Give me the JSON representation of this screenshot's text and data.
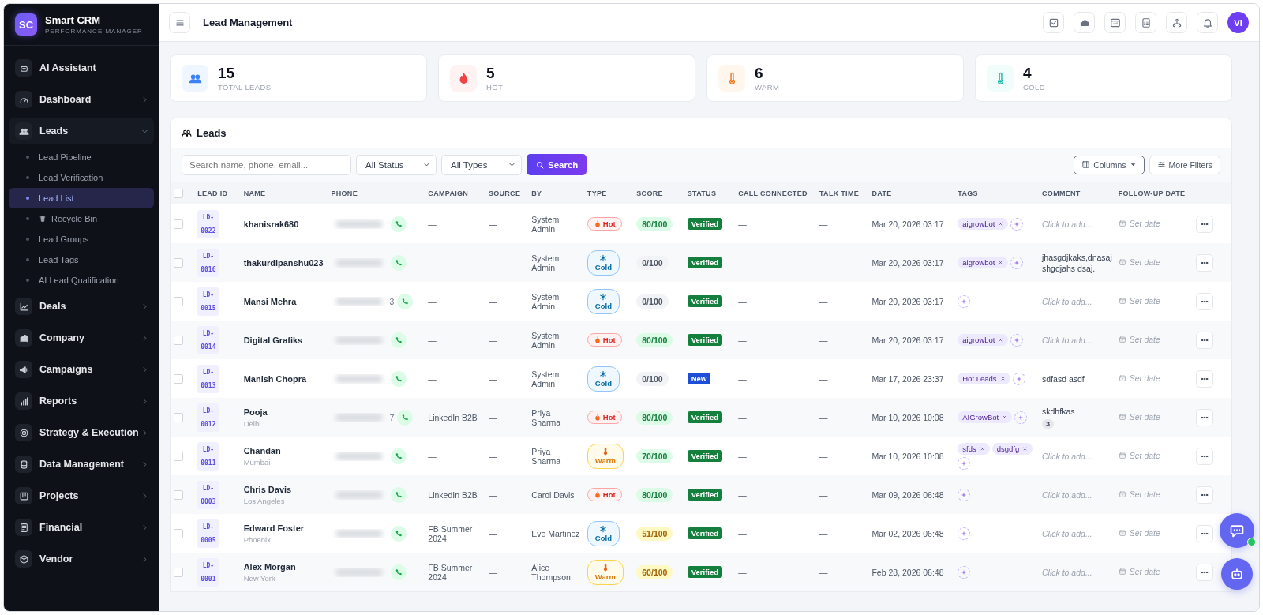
{
  "brand": {
    "logo": "SC",
    "name": "Smart CRM",
    "subtitle": "PERFORMANCE MANAGER"
  },
  "sidebar": {
    "items": [
      {
        "label": "AI Assistant",
        "expandable": false,
        "expanded": false
      },
      {
        "label": "Dashboard",
        "expandable": true,
        "expanded": false
      },
      {
        "label": "Leads",
        "expandable": true,
        "expanded": true,
        "children": [
          {
            "label": "Lead Pipeline",
            "selected": false,
            "kind": "label"
          },
          {
            "label": "Lead Verification",
            "selected": false,
            "kind": "label"
          },
          {
            "label": "Lead List",
            "selected": true,
            "kind": "label"
          },
          {
            "label": "Recycle Bin",
            "selected": false,
            "kind": "icon-label"
          },
          {
            "label": "Lead Groups",
            "selected": false,
            "kind": "label"
          },
          {
            "label": "Lead Tags",
            "selected": false,
            "kind": "label"
          },
          {
            "label": "AI Lead Qualification",
            "selected": false,
            "kind": "label"
          }
        ]
      },
      {
        "label": "Deals",
        "expandable": true,
        "expanded": false
      },
      {
        "label": "Company",
        "expandable": true,
        "expanded": false
      },
      {
        "label": "Campaigns",
        "expandable": true,
        "expanded": false
      },
      {
        "label": "Reports",
        "expandable": true,
        "expanded": false
      },
      {
        "label": "Strategy & Execution",
        "expandable": true,
        "expanded": false
      },
      {
        "label": "Data Management",
        "expandable": true,
        "expanded": false
      },
      {
        "label": "Projects",
        "expandable": true,
        "expanded": false
      },
      {
        "label": "Financial",
        "expandable": true,
        "expanded": false
      },
      {
        "label": "Vendor",
        "expandable": true,
        "expanded": false
      }
    ]
  },
  "header": {
    "title": "Lead Management",
    "avatar": "VI"
  },
  "stats": [
    {
      "kind": "total",
      "value": "15",
      "label": "TOTAL LEADS"
    },
    {
      "kind": "hot",
      "value": "5",
      "label": "HOT"
    },
    {
      "kind": "warm",
      "value": "6",
      "label": "WARM"
    },
    {
      "kind": "cold",
      "value": "4",
      "label": "COLD"
    }
  ],
  "leads": {
    "title": "Leads",
    "search": {
      "placeholder": "Search name, phone, email..."
    },
    "filters": [
      "All Status",
      "All Types"
    ],
    "search_button": "Search",
    "columns_button": "Columns",
    "more_filters_button": "More Filters"
  },
  "table": {
    "select_all_checked": false,
    "columns": [
      "LEAD ID",
      "NAME",
      "PHONE",
      "CAMPAIGN",
      "SOURCE",
      "BY",
      "TYPE",
      "SCORE",
      "STATUS",
      "CALL CONNECTED",
      "TALK TIME",
      "DATE",
      "TAGS",
      "COMMENT",
      "FOLLOW-UP DATE"
    ],
    "rows": [
      {
        "checked": false,
        "id": [
          "LD-",
          "0022"
        ],
        "name": "khanisrak680",
        "phone_tail": "",
        "campaign": "—",
        "source": "—",
        "by": "System Admin",
        "type": {
          "kind": "hot",
          "label": "Hot"
        },
        "score": {
          "kind": "high",
          "label": "80/100"
        },
        "status": {
          "kind": "verified",
          "label": "Verified"
        },
        "call_connected": "—",
        "talk_time": "—",
        "date": "Mar 20, 2026 03:17",
        "tags": [
          "aigrowbot"
        ],
        "comment": {
          "placeholder": "Click to add..."
        },
        "follow_up": "Set date"
      },
      {
        "checked": false,
        "id": [
          "LD-",
          "0016"
        ],
        "name": "thakurdipanshu023",
        "phone_tail": "",
        "campaign": "—",
        "source": "—",
        "by": "System Admin",
        "type": {
          "kind": "cold",
          "label": "Cold"
        },
        "score": {
          "kind": "zero",
          "label": "0/100"
        },
        "status": {
          "kind": "verified",
          "label": "Verified"
        },
        "call_connected": "—",
        "talk_time": "—",
        "date": "Mar 20, 2026 03:17",
        "tags": [
          "aigrowbot"
        ],
        "comment": {
          "text": "jhasgdjkaks,dnasajshgdjahs dsaj."
        },
        "follow_up": "Set date"
      },
      {
        "checked": false,
        "id": [
          "LD-",
          "0015"
        ],
        "name": "Mansi Mehra",
        "phone_tail": "3",
        "campaign": "—",
        "source": "—",
        "by": "System Admin",
        "type": {
          "kind": "cold",
          "label": "Cold"
        },
        "score": {
          "kind": "zero",
          "label": "0/100"
        },
        "status": {
          "kind": "verified",
          "label": "Verified"
        },
        "call_connected": "—",
        "talk_time": "—",
        "date": "Mar 20, 2026 03:17",
        "tags": [],
        "comment": {
          "placeholder": "Click to add..."
        },
        "follow_up": "Set date"
      },
      {
        "checked": false,
        "id": [
          "LD-",
          "0014"
        ],
        "name": "Digital Grafiks",
        "phone_tail": "",
        "campaign": "—",
        "source": "—",
        "by": "System Admin",
        "type": {
          "kind": "hot",
          "label": "Hot"
        },
        "score": {
          "kind": "high",
          "label": "80/100"
        },
        "status": {
          "kind": "verified",
          "label": "Verified"
        },
        "call_connected": "—",
        "talk_time": "—",
        "date": "Mar 20, 2026 03:17",
        "tags": [
          "aigrowbot"
        ],
        "comment": {
          "placeholder": "Click to add..."
        },
        "follow_up": "Set date"
      },
      {
        "checked": false,
        "id": [
          "LD-",
          "0013"
        ],
        "name": "Manish Chopra",
        "phone_tail": "",
        "campaign": "—",
        "source": "—",
        "by": "System Admin",
        "type": {
          "kind": "cold",
          "label": "Cold"
        },
        "score": {
          "kind": "zero",
          "label": "0/100"
        },
        "status": {
          "kind": "new",
          "label": "New"
        },
        "call_connected": "—",
        "talk_time": "—",
        "date": "Mar 17, 2026 23:37",
        "tags": [
          "Hot Leads"
        ],
        "comment": {
          "text": "sdfasd asdf"
        },
        "follow_up": "Set date"
      },
      {
        "checked": false,
        "id": [
          "LD-",
          "0012"
        ],
        "name": "Pooja",
        "city": "Delhi",
        "phone_tail": "7",
        "campaign": "LinkedIn B2B",
        "source": "—",
        "by": "Priya Sharma",
        "type": {
          "kind": "hot",
          "label": "Hot"
        },
        "score": {
          "kind": "high",
          "label": "80/100"
        },
        "status": {
          "kind": "verified",
          "label": "Verified"
        },
        "call_connected": "—",
        "talk_time": "—",
        "date": "Mar 10, 2026 10:08",
        "tags": [
          "AIGrowBot"
        ],
        "comment": {
          "text": "skdhfkas",
          "count": "3"
        },
        "follow_up": "Set date"
      },
      {
        "checked": false,
        "id": [
          "LD-",
          "0011"
        ],
        "name": "Chandan",
        "city": "Mumbai",
        "phone_tail": "",
        "campaign": "—",
        "source": "—",
        "by": "Priya Sharma",
        "type": {
          "kind": "warm",
          "label": "Warm"
        },
        "score": {
          "kind": "high",
          "label": "70/100"
        },
        "status": {
          "kind": "verified",
          "label": "Verified"
        },
        "call_connected": "—",
        "talk_time": "—",
        "date": "Mar 10, 2026 10:08",
        "tags": [
          "sfds",
          "dsgdfg"
        ],
        "comment": {
          "placeholder": "Click to add..."
        },
        "follow_up": "Set date"
      },
      {
        "checked": false,
        "id": [
          "LD-",
          "0003"
        ],
        "name": "Chris Davis",
        "city": "Los Angeles",
        "phone_tail": "",
        "campaign": "LinkedIn B2B",
        "source": "—",
        "by": "Carol Davis",
        "type": {
          "kind": "hot",
          "label": "Hot"
        },
        "score": {
          "kind": "high",
          "label": "80/100"
        },
        "status": {
          "kind": "verified",
          "label": "Verified"
        },
        "call_connected": "—",
        "talk_time": "—",
        "date": "Mar 09, 2026 06:48",
        "tags": [],
        "comment": {
          "placeholder": "Click to add..."
        },
        "follow_up": "Set date"
      },
      {
        "checked": false,
        "id": [
          "LD-",
          "0005"
        ],
        "name": "Edward Foster",
        "city": "Phoenix",
        "phone_tail": "",
        "campaign": "FB Summer 2024",
        "source": "—",
        "by": "Eve Martinez",
        "type": {
          "kind": "cold",
          "label": "Cold"
        },
        "score": {
          "kind": "mid",
          "label": "51/100"
        },
        "status": {
          "kind": "verified",
          "label": "Verified"
        },
        "call_connected": "—",
        "talk_time": "—",
        "date": "Mar 02, 2026 06:48",
        "tags": [],
        "comment": {
          "placeholder": "Click to add..."
        },
        "follow_up": "Set date"
      },
      {
        "checked": false,
        "id": [
          "LD-",
          "0001"
        ],
        "name": "Alex Morgan",
        "city": "New York",
        "phone_tail": "",
        "campaign": "FB Summer 2024",
        "source": "—",
        "by": "Alice Thompson",
        "type": {
          "kind": "warm",
          "label": "Warm"
        },
        "score": {
          "kind": "mid",
          "label": "60/100"
        },
        "status": {
          "kind": "verified",
          "label": "Verified"
        },
        "call_connected": "—",
        "talk_time": "—",
        "date": "Feb 28, 2026 06:48",
        "tags": [],
        "comment": {
          "placeholder": "Click to add..."
        },
        "follow_up": "Set date"
      }
    ]
  }
}
